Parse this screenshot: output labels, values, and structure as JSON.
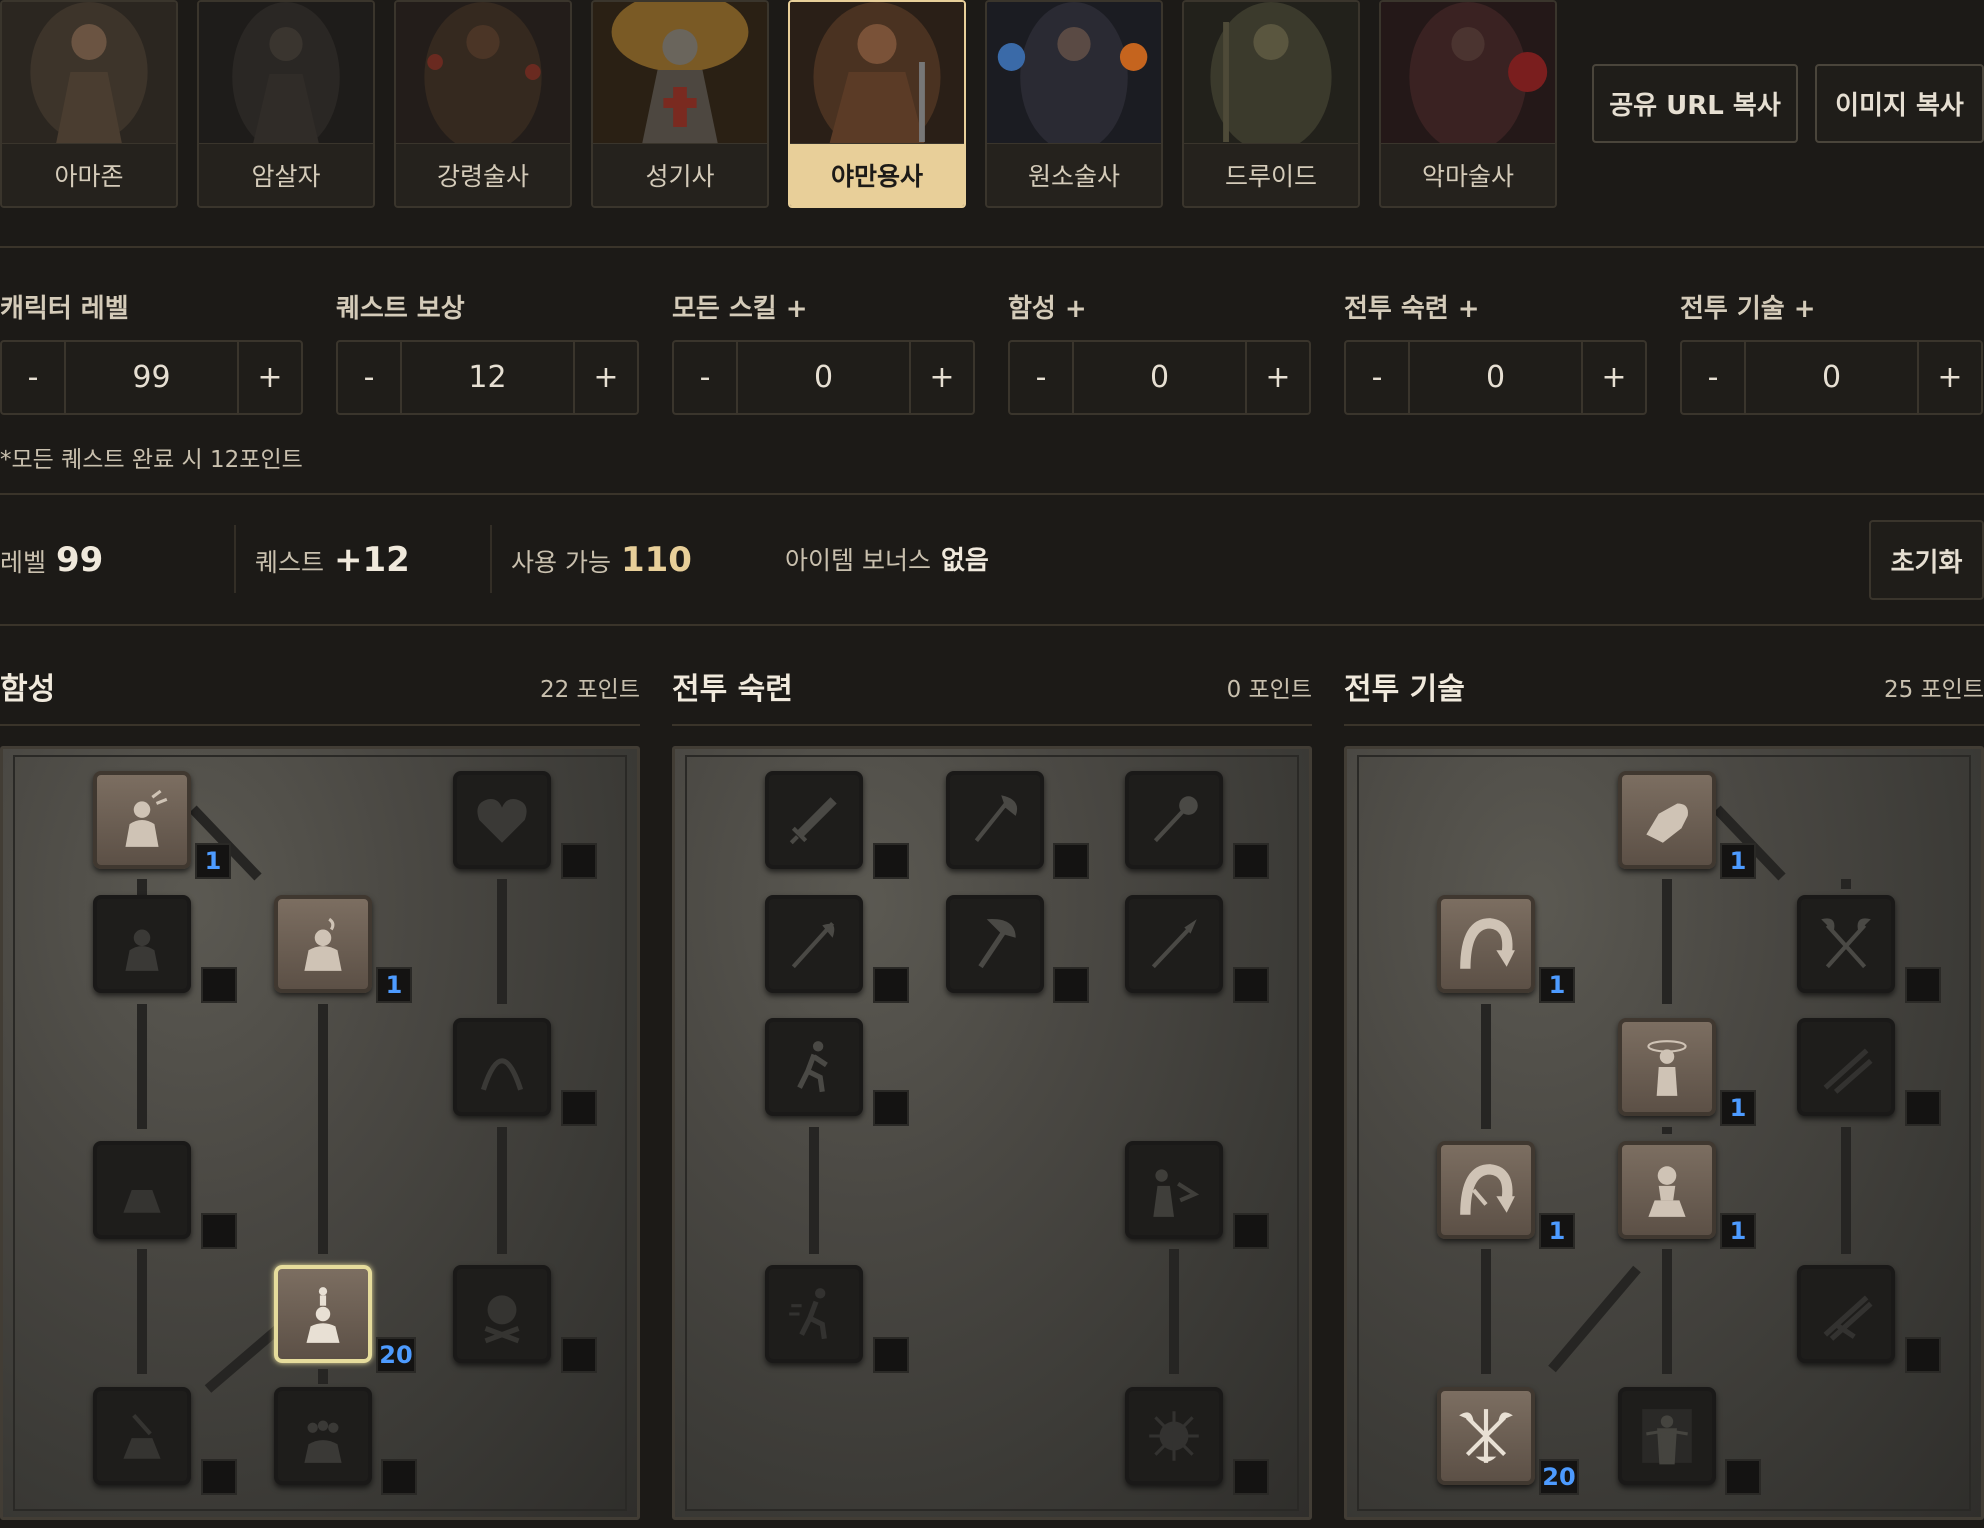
{
  "classes": [
    {
      "label": "아마존",
      "active": false
    },
    {
      "label": "암살자",
      "active": false
    },
    {
      "label": "강령술사",
      "active": false
    },
    {
      "label": "성기사",
      "active": false
    },
    {
      "label": "야만용사",
      "active": true
    },
    {
      "label": "원소술사",
      "active": false
    },
    {
      "label": "드루이드",
      "active": false
    },
    {
      "label": "악마술사",
      "active": false
    }
  ],
  "actions": {
    "share_url": "공유 URL 복사",
    "copy_image": "이미지 복사"
  },
  "fields": [
    {
      "label": "캐릭터 레벨",
      "value": "99"
    },
    {
      "label": "퀘스트 보상",
      "value": "12"
    },
    {
      "label": "모든 스킬 +",
      "value": "0"
    },
    {
      "label": "함성 +",
      "value": "0"
    },
    {
      "label": "전투 숙련 +",
      "value": "0"
    },
    {
      "label": "전투 기술 +",
      "value": "0"
    }
  ],
  "minus": "-",
  "plus": "+",
  "quest_note": "*모든 퀘스트 완료 시 12포인트",
  "summary": {
    "level_label": "레벨",
    "level_value": "99",
    "quest_label": "퀘스트",
    "quest_value": "+12",
    "available_label": "사용 가능",
    "available_value": "110",
    "item_label": "아이템 보너스",
    "item_value": "없음"
  },
  "reset_label": "초기화",
  "trees": [
    {
      "title": "함성",
      "points": "22 포인트",
      "skills": [
        {
          "icon": "howl-icon",
          "level": "1",
          "on": true
        },
        {
          "icon": "find-potion-icon",
          "level": "",
          "on": false
        },
        {
          "icon": "taunt-icon",
          "level": "1",
          "on": true
        },
        {
          "icon": "find-item-icon",
          "level": "",
          "on": false
        },
        {
          "icon": "battle-cry-icon",
          "level": "",
          "on": false
        },
        {
          "icon": "shout-icon",
          "level": "20",
          "on": true
        },
        {
          "icon": "grim-ward-icon",
          "level": "",
          "on": false
        },
        {
          "icon": "war-cry-icon",
          "level": "",
          "on": false
        },
        {
          "icon": "battle-orders-icon",
          "level": "",
          "on": false
        },
        {
          "icon": "battle-command-icon",
          "level": "",
          "on": false
        }
      ]
    },
    {
      "title": "전투 숙련",
      "points": "0 포인트",
      "skills": [
        {
          "icon": "sword-mastery-icon",
          "level": "",
          "on": false
        },
        {
          "icon": "axe-mastery-icon",
          "level": "",
          "on": false
        },
        {
          "icon": "mace-mastery-icon",
          "level": "",
          "on": false
        },
        {
          "icon": "polearm-mastery-icon",
          "level": "",
          "on": false
        },
        {
          "icon": "throwing-mastery-icon",
          "level": "",
          "on": false
        },
        {
          "icon": "spear-mastery-icon",
          "level": "",
          "on": false
        },
        {
          "icon": "increased-stamina-icon",
          "level": "",
          "on": false
        },
        {
          "icon": "iron-skin-icon",
          "level": "",
          "on": false
        },
        {
          "icon": "increased-speed-icon",
          "level": "",
          "on": false
        },
        {
          "icon": "natural-resistance-icon",
          "level": "",
          "on": false
        }
      ]
    },
    {
      "title": "전투 기술",
      "points": "25 포인트",
      "skills": [
        {
          "icon": "bash-icon",
          "level": "1",
          "on": true
        },
        {
          "icon": "leap-icon",
          "level": "1",
          "on": true
        },
        {
          "icon": "double-swing-icon",
          "level": "",
          "on": false
        },
        {
          "icon": "stun-icon",
          "level": "1",
          "on": true
        },
        {
          "icon": "double-throw-icon",
          "level": "",
          "on": false
        },
        {
          "icon": "leap-attack-icon",
          "level": "1",
          "on": true
        },
        {
          "icon": "concentrate-icon",
          "level": "1",
          "on": true
        },
        {
          "icon": "frenzy-icon",
          "level": "",
          "on": false
        },
        {
          "icon": "whirlwind-icon",
          "level": "20",
          "on": true
        },
        {
          "icon": "berserk-icon",
          "level": "",
          "on": false
        }
      ]
    }
  ]
}
